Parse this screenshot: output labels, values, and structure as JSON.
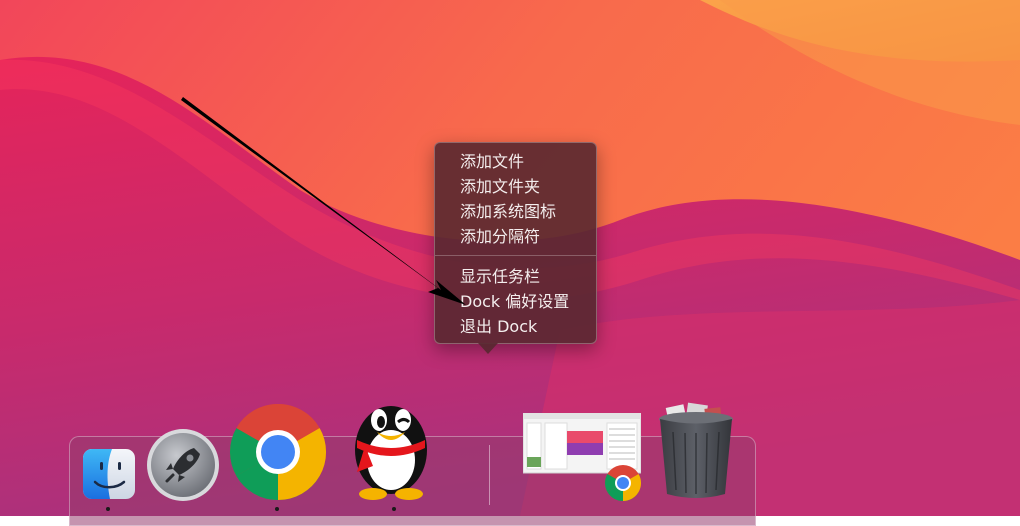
{
  "context_menu": {
    "group1": [
      {
        "label": "添加文件"
      },
      {
        "label": "添加文件夹"
      },
      {
        "label": "添加系统图标"
      },
      {
        "label": "添加分隔符"
      }
    ],
    "group2": [
      {
        "label": "显示任务栏"
      },
      {
        "label": "Dock 偏好设置"
      },
      {
        "label": "退出 Dock"
      }
    ]
  },
  "dock": {
    "icons": [
      "finder-icon",
      "launchpad-icon",
      "chrome-icon",
      "qq-icon",
      "chrome-window-preview",
      "trash-icon"
    ]
  },
  "colors": {
    "menu_bg": "#582830",
    "menu_text": "#f4eeee",
    "wallpaper_top": "#f6674d",
    "wallpaper_bottom": "#b92f7a"
  }
}
